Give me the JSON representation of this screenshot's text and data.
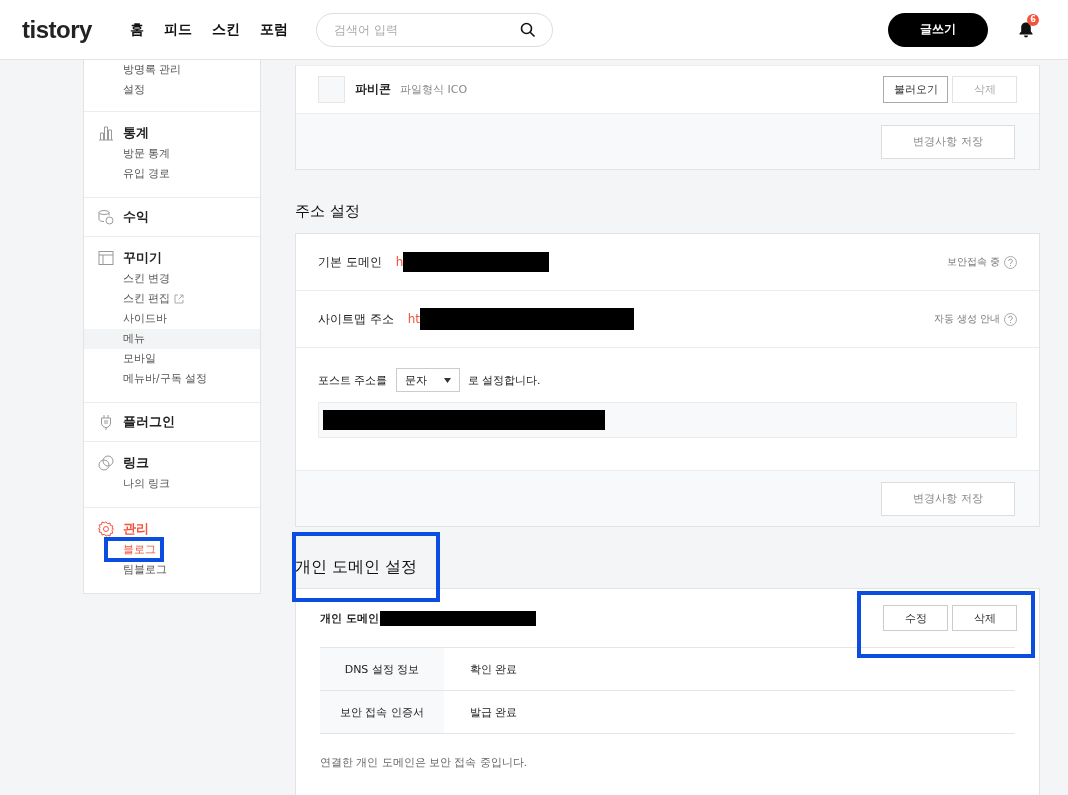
{
  "header": {
    "logo": "tistory",
    "nav": [
      "홈",
      "피드",
      "스킨",
      "포럼"
    ],
    "search": {
      "placeholder": "검색어 입력"
    },
    "write_button": "글쓰기",
    "notification_count": "6"
  },
  "sidebar": {
    "groups": [
      {
        "items": [
          {
            "label": "방명록 관리",
            "selected": false
          },
          {
            "label": "설정",
            "selected": false
          }
        ]
      },
      {
        "title": "통계",
        "selected": false,
        "items": [
          {
            "label": "방문 통계",
            "selected": false
          },
          {
            "label": "유입 경로",
            "selected": false
          }
        ]
      },
      {
        "title": "수익",
        "selected": false
      },
      {
        "title": "꾸미기",
        "selected": false,
        "items": [
          {
            "label": "스킨 변경",
            "selected": false
          },
          {
            "label": "스킨 편집",
            "selected": false,
            "external": true
          },
          {
            "label": "사이드바",
            "selected": false
          },
          {
            "label": "메뉴",
            "selected": true
          },
          {
            "label": "모바일",
            "selected": false
          },
          {
            "label": "메뉴바/구독 설정",
            "selected": false
          }
        ]
      },
      {
        "title": "플러그인",
        "selected": false
      },
      {
        "title": "링크",
        "selected": false,
        "items": [
          {
            "label": "나의 링크",
            "selected": false
          }
        ]
      },
      {
        "title": "관리",
        "selected": true,
        "items": [
          {
            "label": "블로그",
            "selected": true
          },
          {
            "label": "팀블로그",
            "selected": false
          }
        ]
      }
    ]
  },
  "favicon": {
    "label": "파비콘",
    "hint": "파일형식 ICO",
    "buttons": [
      {
        "label": "불러오기",
        "disabled": false
      },
      {
        "label": "삭제",
        "disabled": true
      }
    ],
    "save_button": "변경사항 저장"
  },
  "address": {
    "title": "주소 설정",
    "rows": [
      {
        "label": "기본 도메인",
        "value": "h",
        "redacted": true,
        "note": "보안접속 중"
      },
      {
        "label": "사이트맵 주소",
        "value": "ht",
        "redacted": true,
        "note": "자동 생성 안내"
      }
    ],
    "post_address": {
      "prefix": "포스트 주소를",
      "select": "문자",
      "suffix": "로 설정합니다.",
      "example_redacted": true
    },
    "save_button": "변경사항 저장"
  },
  "custom_domain": {
    "title": "개인 도메인 설정",
    "label": "개인 도메인",
    "redacted": true,
    "buttons": [
      "수정",
      "삭제"
    ],
    "table": [
      {
        "name": "DNS 설정 정보",
        "value": "확인 완료"
      },
      {
        "name": "보안 접속 인증서",
        "value": "발급 완료"
      }
    ],
    "note": "연결한 개인 도메인은 보안 접속 중입니다."
  }
}
